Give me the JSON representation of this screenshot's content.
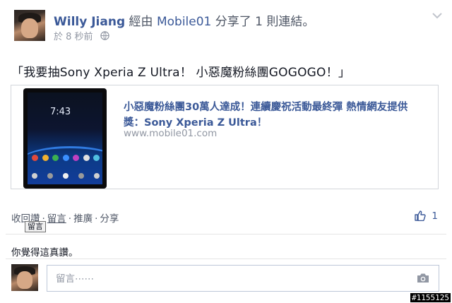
{
  "post": {
    "author": "Willy Jiang",
    "via_prefix": "經由",
    "app_name": "Mobile01",
    "via_suffix": "分享了 1 則連結。",
    "time": "於 8 秒前",
    "message": "「我要抽Sony Xperia Z Ultra！ 小惡魔粉絲團GOGOGO！」"
  },
  "link": {
    "title": "小惡魔粉絲團30萬人達成！連續慶祝活動最終彈 熱情網友提供獎：Sony Xperia Z Ultra！",
    "domain": "www.mobile01.com",
    "thumb_clock": "7:43"
  },
  "actions": {
    "unlike": "收回讚",
    "comment": "留言",
    "promote": "推廣",
    "share": "分享",
    "tooltip": "留言",
    "like_count": "1"
  },
  "likes_text": "你覺得這真讚。",
  "comment_box": {
    "placeholder": "留言⋯⋯"
  },
  "watermark": "#1155125",
  "colors": {
    "link_blue": "#3b5998",
    "meta_gray": "#9197a3"
  },
  "icons": [
    "globe-icon",
    "chevron-down-icon",
    "thumbs-up-icon",
    "camera-icon"
  ]
}
